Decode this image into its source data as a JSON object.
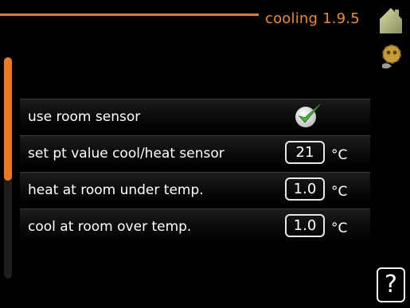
{
  "header": {
    "title": "cooling 1.9.5"
  },
  "icons": {
    "home": "house-icon",
    "settings": "gear-icon",
    "help": "help-icon"
  },
  "colors": {
    "accent": "#f08a24",
    "scroll": "#f0791d"
  },
  "rows": [
    {
      "label": "use room sensor",
      "checked": true
    },
    {
      "label": "set pt value cool/heat sensor",
      "value": "21",
      "unit": "°C"
    },
    {
      "label": "heat at room under temp.",
      "value": "1.0",
      "unit": "°C"
    },
    {
      "label": "cool at room over temp.",
      "value": "1.0",
      "unit": "°C"
    }
  ],
  "help": {
    "label": "?"
  }
}
